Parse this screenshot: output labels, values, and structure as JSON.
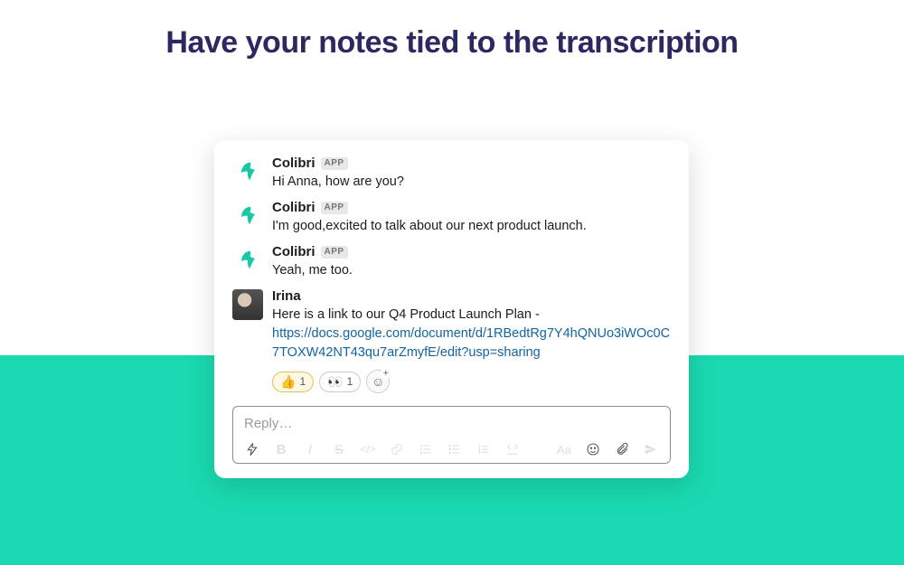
{
  "headline": "Have your notes tied to the transcription",
  "app_badge": "APP",
  "messages": [
    {
      "author": "Colibri",
      "is_app": true,
      "text": "Hi Anna, how are you?"
    },
    {
      "author": "Colibri",
      "is_app": true,
      "text": "I'm good,excited to talk about our next product launch."
    },
    {
      "author": "Colibri",
      "is_app": true,
      "text": "Yeah, me too."
    },
    {
      "author": "Irina",
      "is_app": false,
      "text_prefix": "Here is a link to our Q4 Product Launch Plan - ",
      "link": "https://docs.google.com/document/d/1RBedtRg7Y4hQNUo3iWOc0C7TOXW42NT43qu7arZmyfE/edit?usp=sharing"
    }
  ],
  "reactions": [
    {
      "emoji": "👍",
      "count": "1"
    },
    {
      "emoji": "👀",
      "count": "1"
    }
  ],
  "composer": {
    "placeholder": "Reply…"
  },
  "toolbar": {
    "bold": "B",
    "italic": "I",
    "strike": "S",
    "code": "</>",
    "aa": "Aa"
  },
  "colors": {
    "accent": "#1ad9b0",
    "headline": "#2b2960",
    "link": "#1264a3"
  }
}
